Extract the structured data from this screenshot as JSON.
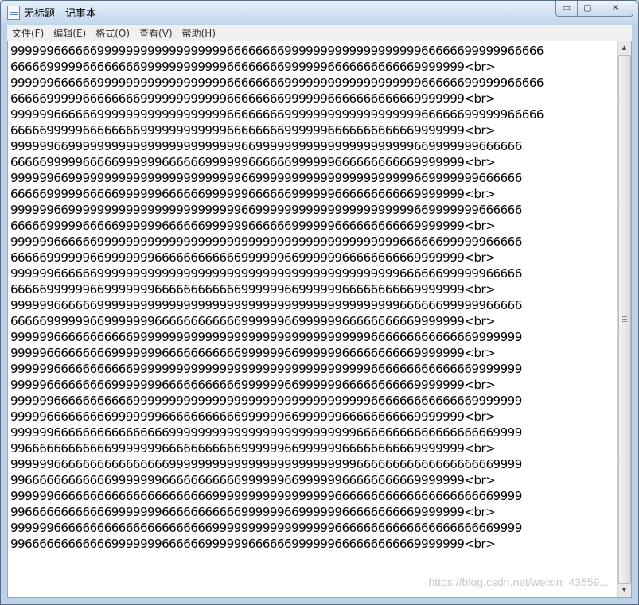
{
  "window": {
    "title": "无标题 - 记事本",
    "minimize_symbol": "▭",
    "maximize_symbol": "▢",
    "close_symbol": "✕"
  },
  "menu": [
    "文件(F)",
    "编辑(E)",
    "格式(O)",
    "查看(V)",
    "帮助(H)"
  ],
  "lines": [
    "99999966666699999999999999999966666666999999999999999999966666699999966666",
    "666669999966666666999999999999666666669999996666666666669999999<br>",
    "99999966666699999999999999999966666666999999999999999999966666699999966666",
    "666669999966666666999999999999666666669999996666666666669999999<br>",
    "99999966666699999999999999999966666666999999999999999999966666699999966666",
    "666669999966666666999999999999666666669999996666666666669999999<br>",
    "99999966999999999999999999999999669999999999999999999999669999999666666",
    "666669999966666999999666666999999666666999999666666666669999999<br>",
    "99999966999999999999999999999999669999999999999999999999669999999666666",
    "666669999966666999999666666999999666666999999666666666669999999<br>",
    "99999966999999999999999999999999669999999999999999999999669999999666666",
    "666669999966666999999666666999999666666999999666666666669999999<br>",
    "99999966666699999999999999999999999999999999999999999966666699999966666",
    "666669999996699999996666666666669999996699999966666666669999999<br>",
    "99999966666699999999999999999999999999999999999999999966666699999966666",
    "666669999996699999996666666666669999996699999966666666669999999<br>",
    "99999966666699999999999999999999999999999999999999999966666699999966666",
    "666669999996699999996666666666669999996699999966666666669999999<br>",
    "99999966666666666999999999999999999999999999999999666666666666669999999",
    "999996666666669999999666666666669999996699999966666666669999999<br>",
    "99999966666666666999999999999999999999999999999999666666666666669999999",
    "999996666666669999999666666666669999996699999966666666669999999<br>",
    "99999966666666666999999999999999999999999999999999666666666666669999999",
    "999996666666669999999666666666669999996699999966666666669999999<br>",
    "99999966666666666666669999999999999999999999999966666666666666666669999",
    "996666666666669999999666666666669999996699999966666666669999999<br>",
    "99999966666666666666669999999999999999999999999966666666666666666669999",
    "996666666666669999999666666666669999996699999966666666669999999<br>",
    "99999966666666666666666666669999999999999999966666666666666666666669999",
    "996666666666669999999666666666669999996699999966666666669999999<br>",
    "99999966666666666666666666669999999999999999966666666666666666666669999",
    "996666666666669999999666666999999666666999999666666666669999999<br>"
  ],
  "watermark": "https://blog.csdn.net/weixin_43559...",
  "colors": {
    "titlebar": "#c6d9ee",
    "menubar": "#f0f0f0",
    "editor_bg": "#ffffff",
    "text": "#000000"
  }
}
